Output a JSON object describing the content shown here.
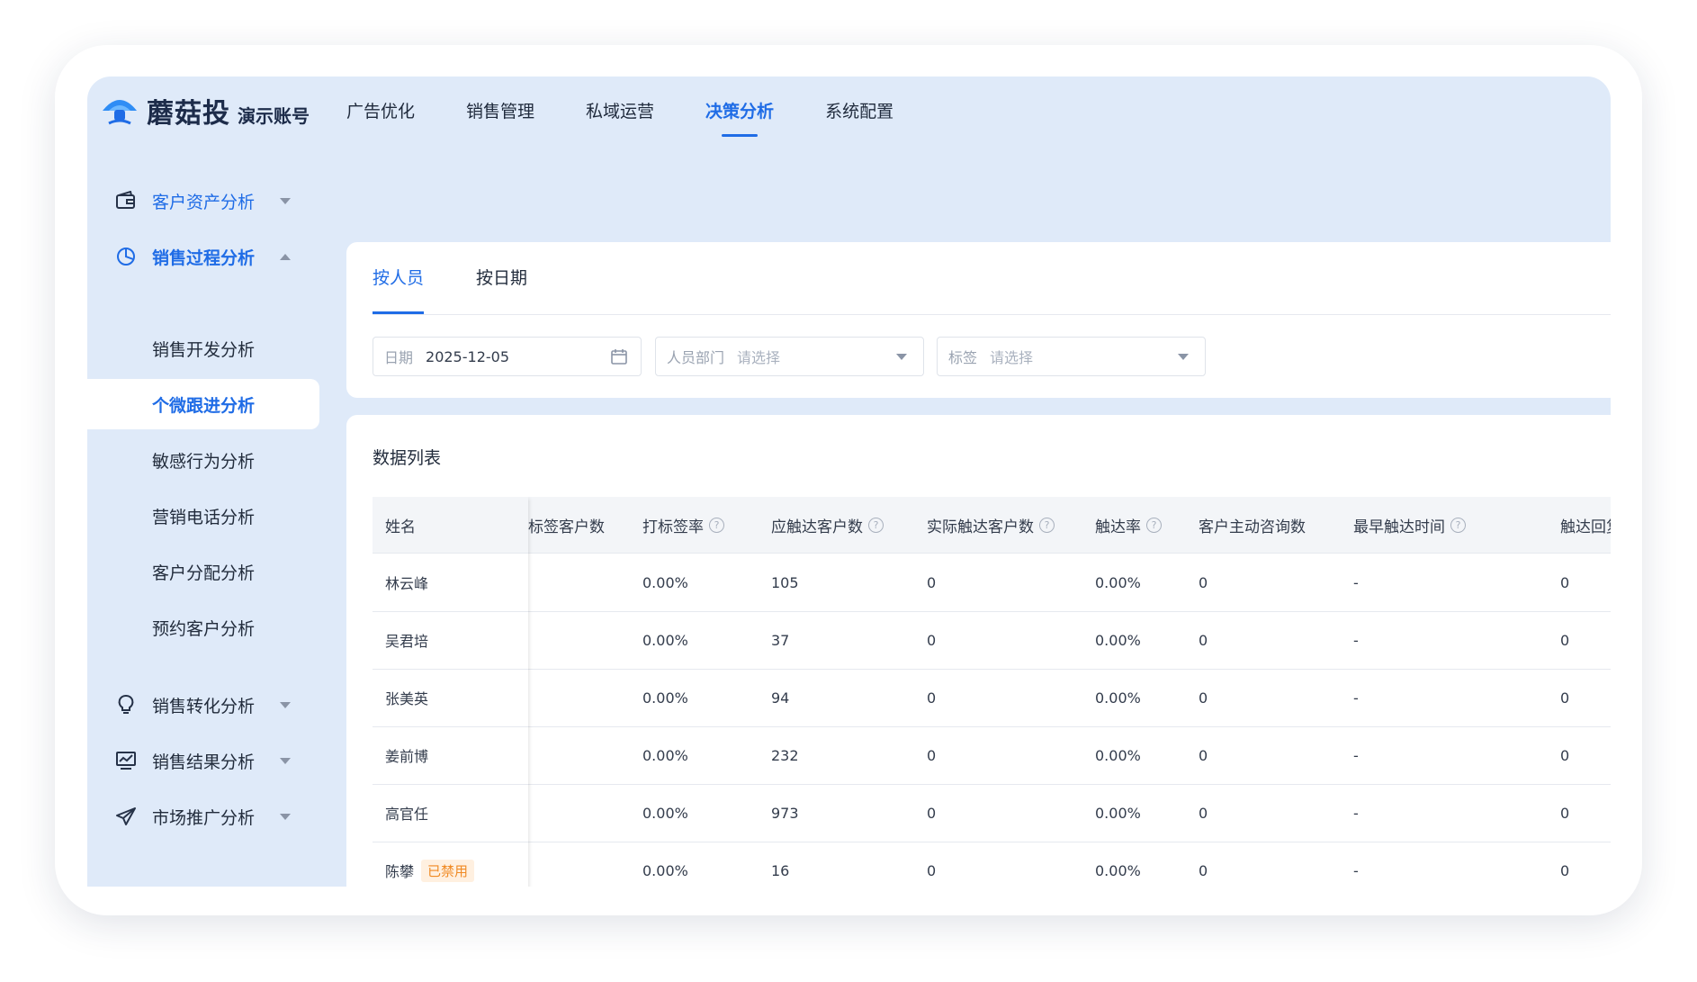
{
  "app": {
    "logo_name": "蘑菇投",
    "logo_sub": "演示账号",
    "brand_color": "#1f6ce6"
  },
  "nav": [
    {
      "label": "广告优化",
      "active": false
    },
    {
      "label": "销售管理",
      "active": false
    },
    {
      "label": "私域运营",
      "active": false
    },
    {
      "label": "决策分析",
      "active": true
    },
    {
      "label": "系统配置",
      "active": false
    }
  ],
  "sidebar": {
    "groups": [
      {
        "label": "客户资产分析",
        "icon": "wallet-icon",
        "expanded": false
      },
      {
        "label": "销售过程分析",
        "icon": "pie-chart-icon",
        "expanded": true
      },
      {
        "label": "销售转化分析",
        "icon": "lightbulb-icon",
        "expanded": false
      },
      {
        "label": "销售结果分析",
        "icon": "monitor-chart-icon",
        "expanded": false
      },
      {
        "label": "市场推广分析",
        "icon": "paper-plane-icon",
        "expanded": false
      }
    ],
    "sub_items": [
      {
        "label": "销售开发分析"
      },
      {
        "label": "个微跟进分析",
        "active": true
      },
      {
        "label": "敏感行为分析"
      },
      {
        "label": "营销电话分析"
      },
      {
        "label": "客户分配分析"
      },
      {
        "label": "预约客户分析"
      }
    ]
  },
  "tabs": [
    {
      "label": "按人员",
      "active": true
    },
    {
      "label": "按日期",
      "active": false
    }
  ],
  "filters": {
    "date_label": "日期",
    "date_value": "2025-12-05",
    "dept_label": "人员部门",
    "dept_placeholder": "请选择",
    "tag_label": "标签",
    "tag_placeholder": "请选择"
  },
  "table": {
    "title": "数据列表",
    "columns": [
      "姓名",
      "标签客户数",
      "打标签率",
      "应触达客户数",
      "实际触达客户数",
      "触达率",
      "客户主动咨询数",
      "最早触达时间",
      "触达回复"
    ],
    "rows": [
      {
        "name": "林云峰",
        "tagged": "",
        "tag_rate": "0.00%",
        "should_reach": "105",
        "actual_reach": "0",
        "reach_rate": "0.00%",
        "inquiries": "0",
        "earliest": "-",
        "replies": "0"
      },
      {
        "name": "吴君培",
        "tagged": "",
        "tag_rate": "0.00%",
        "should_reach": "37",
        "actual_reach": "0",
        "reach_rate": "0.00%",
        "inquiries": "0",
        "earliest": "-",
        "replies": "0"
      },
      {
        "name": "张美英",
        "tagged": "",
        "tag_rate": "0.00%",
        "should_reach": "94",
        "actual_reach": "0",
        "reach_rate": "0.00%",
        "inquiries": "0",
        "earliest": "-",
        "replies": "0"
      },
      {
        "name": "姜前博",
        "tagged": "",
        "tag_rate": "0.00%",
        "should_reach": "232",
        "actual_reach": "0",
        "reach_rate": "0.00%",
        "inquiries": "0",
        "earliest": "-",
        "replies": "0"
      },
      {
        "name": "高官任",
        "tagged": "",
        "tag_rate": "0.00%",
        "should_reach": "973",
        "actual_reach": "0",
        "reach_rate": "0.00%",
        "inquiries": "0",
        "earliest": "-",
        "replies": "0"
      },
      {
        "name": "陈攀",
        "badge": "已禁用",
        "tagged": "",
        "tag_rate": "0.00%",
        "should_reach": "16",
        "actual_reach": "0",
        "reach_rate": "0.00%",
        "inquiries": "0",
        "earliest": "-",
        "replies": "0"
      }
    ]
  }
}
